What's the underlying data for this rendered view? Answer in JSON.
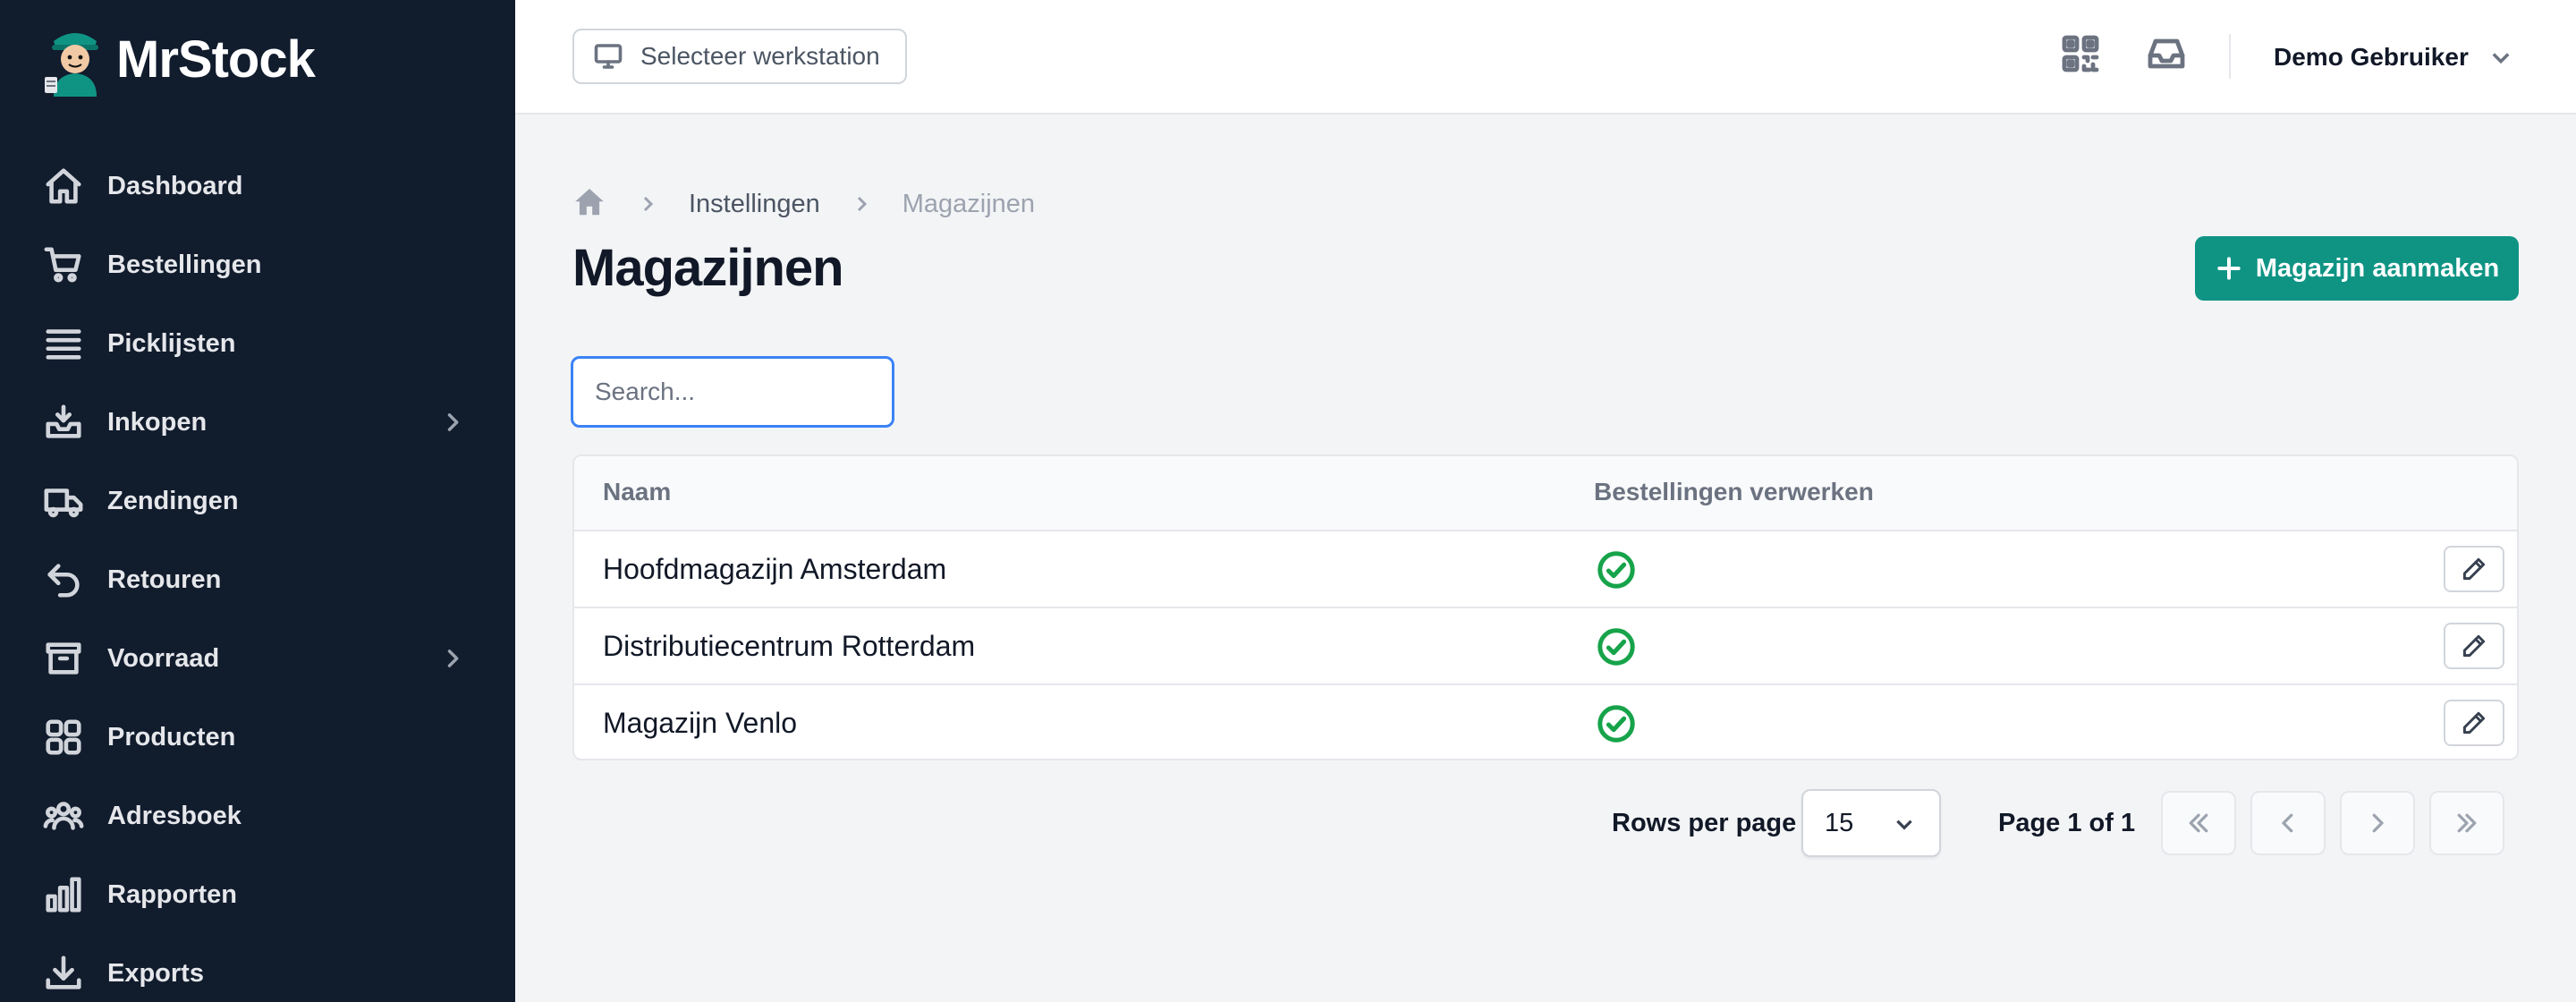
{
  "app": {
    "name": "MrStock"
  },
  "sidebar": {
    "items": [
      {
        "label": "Dashboard",
        "icon": "home-icon",
        "has_children": false
      },
      {
        "label": "Bestellingen",
        "icon": "cart-icon",
        "has_children": false
      },
      {
        "label": "Picklijsten",
        "icon": "list-icon",
        "has_children": false
      },
      {
        "label": "Inkopen",
        "icon": "inbox-download-icon",
        "has_children": true
      },
      {
        "label": "Zendingen",
        "icon": "truck-icon",
        "has_children": false
      },
      {
        "label": "Retouren",
        "icon": "return-arrow-icon",
        "has_children": false
      },
      {
        "label": "Voorraad",
        "icon": "archive-box-icon",
        "has_children": true
      },
      {
        "label": "Producten",
        "icon": "grid-icon",
        "has_children": false
      },
      {
        "label": "Adresboek",
        "icon": "users-icon",
        "has_children": false
      },
      {
        "label": "Rapporten",
        "icon": "bar-chart-icon",
        "has_children": false
      },
      {
        "label": "Exports",
        "icon": "download-icon",
        "has_children": false
      }
    ]
  },
  "topbar": {
    "workstation_label": "Selecteer werkstation",
    "user_name": "Demo Gebruiker"
  },
  "breadcrumb": {
    "items": [
      "Instellingen",
      "Magazijnen"
    ]
  },
  "page": {
    "title": "Magazijnen",
    "create_button": "Magazijn aanmaken",
    "search_placeholder": "Search..."
  },
  "table": {
    "columns": [
      "Naam",
      "Bestellingen verwerken"
    ],
    "rows": [
      {
        "name": "Hoofdmagazijn Amsterdam",
        "process_orders": true
      },
      {
        "name": "Distributiecentrum Rotterdam",
        "process_orders": true
      },
      {
        "name": "Magazijn Venlo",
        "process_orders": true
      }
    ]
  },
  "pagination": {
    "rows_per_page_label": "Rows per page",
    "rows_per_page_value": "15",
    "page_info": "Page 1 of 1"
  },
  "colors": {
    "sidebar_bg": "#111c2d",
    "accent": "#0f9484",
    "success": "#16a34a",
    "focus": "#3b82f6"
  }
}
